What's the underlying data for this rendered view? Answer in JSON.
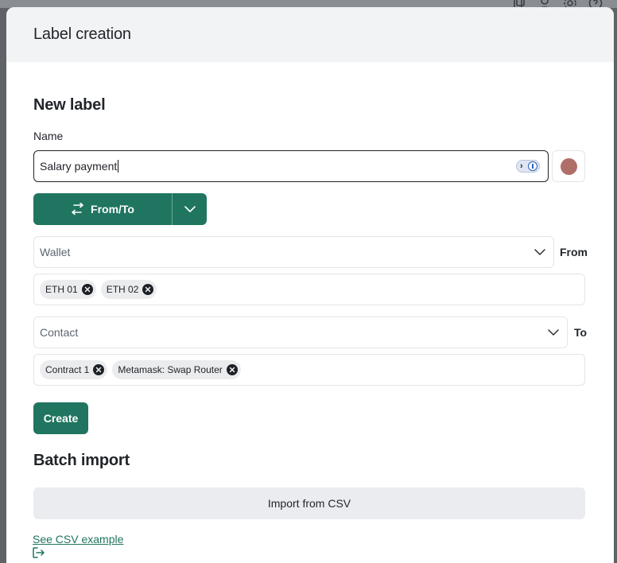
{
  "modal": {
    "title": "Label creation"
  },
  "new_label": {
    "section_title": "New label",
    "name_label": "Name",
    "name_value": "Salary payment",
    "color_swatch": "#b06e69",
    "direction_button_label": "From/To"
  },
  "from": {
    "select_placeholder": "Wallet",
    "side_label": "From",
    "tags": [
      "ETH 01",
      "ETH 02"
    ]
  },
  "to": {
    "select_placeholder": "Contact",
    "side_label": "To",
    "tags": [
      "Contract 1",
      "Metamask: Swap Router"
    ]
  },
  "actions": {
    "create_label": "Create"
  },
  "batch": {
    "section_title": "Batch import",
    "import_button": "Import from CSV",
    "example_link": "See CSV example"
  },
  "colors": {
    "accent": "#1f7560",
    "header_bg": "#f2f3f5",
    "tag_bg": "#ebecee"
  },
  "icons": {
    "direction": "arrows-left-right-icon",
    "dropdown": "chevron-down-icon",
    "remove_tag": "close-circle-icon",
    "external_link": "external-link-icon",
    "password_manager": "password-manager-icon"
  }
}
